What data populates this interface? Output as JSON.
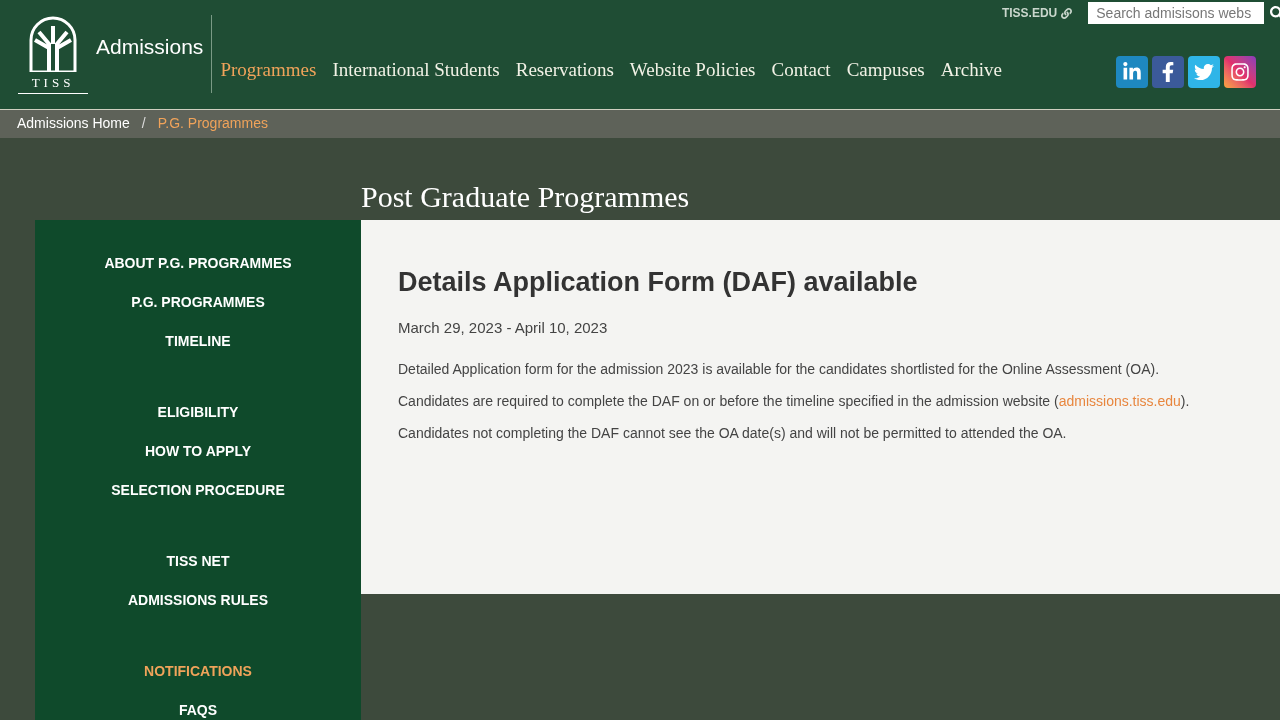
{
  "header": {
    "logo_text": "TISS",
    "site_title": "Admissions",
    "external_link": "TISS.EDU",
    "search": {
      "placeholder": "Search admisisons webs"
    },
    "nav": [
      {
        "label": "Programmes",
        "selected": true
      },
      {
        "label": "International Students",
        "selected": false
      },
      {
        "label": "Reservations",
        "selected": false
      },
      {
        "label": "Website Policies",
        "selected": false
      },
      {
        "label": "Contact",
        "selected": false
      },
      {
        "label": "Campuses",
        "selected": false
      },
      {
        "label": "Archive",
        "selected": false
      }
    ],
    "social": [
      {
        "kind": "linkedin"
      },
      {
        "kind": "facebook"
      },
      {
        "kind": "twitter"
      },
      {
        "kind": "instagram"
      }
    ]
  },
  "breadcrumb_separator": "/",
  "breadcrumb": [
    {
      "label": "Admissions Home",
      "selected": false
    },
    {
      "label": "P.G. Programmes",
      "selected": true
    }
  ],
  "page_title": "Post Graduate Programmes",
  "sidebar": {
    "groups": [
      [
        {
          "label": "ABOUT P.G. PROGRAMMES",
          "selected": false
        },
        {
          "label": "P.G. PROGRAMMES",
          "selected": false
        },
        {
          "label": "TIMELINE",
          "selected": false
        }
      ],
      [
        {
          "label": "ELIGIBILITY",
          "selected": false
        },
        {
          "label": "HOW TO APPLY",
          "selected": false
        },
        {
          "label": "SELECTION PROCEDURE",
          "selected": false
        }
      ],
      [
        {
          "label": "TISS NET",
          "selected": false
        },
        {
          "label": "ADMISSIONS RULES",
          "selected": false
        }
      ],
      [
        {
          "label": "NOTIFICATIONS",
          "selected": true
        },
        {
          "label": "FAQS",
          "selected": false
        }
      ]
    ]
  },
  "notice": {
    "title": "Details Application Form (DAF) available",
    "date": "March 29, 2023 - April 10, 2023",
    "lines": [
      {
        "text": "Detailed Application form for the admission 2023 is available for the candidates shortlisted for the Online Assessment (OA)."
      },
      {
        "text": "Candidates are required to complete the DAF on or before the timeline specified in the admission website (",
        "link": "admissions.tiss.edu",
        "after": ")."
      },
      {
        "text": "Candidates not completing the DAF cannot see the OA date(s) and will not be permitted to attended the OA."
      }
    ]
  }
}
